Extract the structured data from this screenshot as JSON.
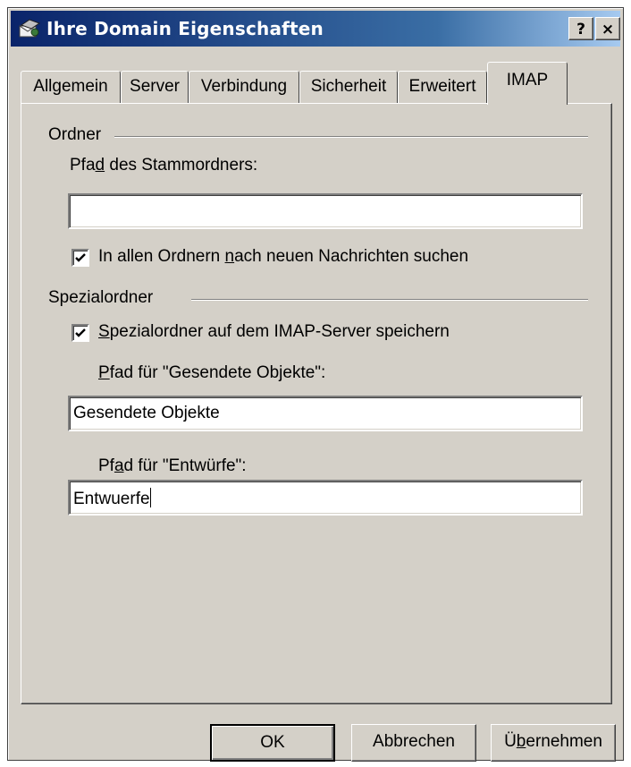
{
  "window": {
    "title": "Ihre Domain Eigenschaften",
    "title_icon": "mail-server-icon",
    "help_button": "?",
    "close_button": "×"
  },
  "tabs": [
    {
      "label": "Allgemein",
      "active": false
    },
    {
      "label": "Server",
      "active": false
    },
    {
      "label": "Verbindung",
      "active": false
    },
    {
      "label": "Sicherheit",
      "active": false
    },
    {
      "label": "Erweitert",
      "active": false
    },
    {
      "label": "IMAP",
      "active": true
    }
  ],
  "folders": {
    "group_label": "Ordner",
    "root_path_label_pre": "Pfa",
    "root_path_label_accel": "d",
    "root_path_label_post": " des Stammordners:",
    "root_path_value": "",
    "check_new_pre": "In allen Ordnern ",
    "check_new_accel": "n",
    "check_new_post": "ach neuen Nachrichten suchen",
    "check_new_checked": true
  },
  "special": {
    "group_label": "Spezialordner",
    "store_accel": "S",
    "store_post": "pezialordner auf dem IMAP-Server speichern",
    "store_checked": true,
    "sent_accel": "P",
    "sent_post": "fad für \"Gesendete Objekte\":",
    "sent_value": "Gesendete Objekte",
    "drafts_pre": "Pf",
    "drafts_accel": "a",
    "drafts_post": "d  für \"Entwürfe\":",
    "drafts_value": "Entwuerfe"
  },
  "buttons": {
    "ok": "OK",
    "cancel": "Abbrechen",
    "apply_pre": "Ü",
    "apply_accel": "b",
    "apply_post": "ernehmen"
  }
}
